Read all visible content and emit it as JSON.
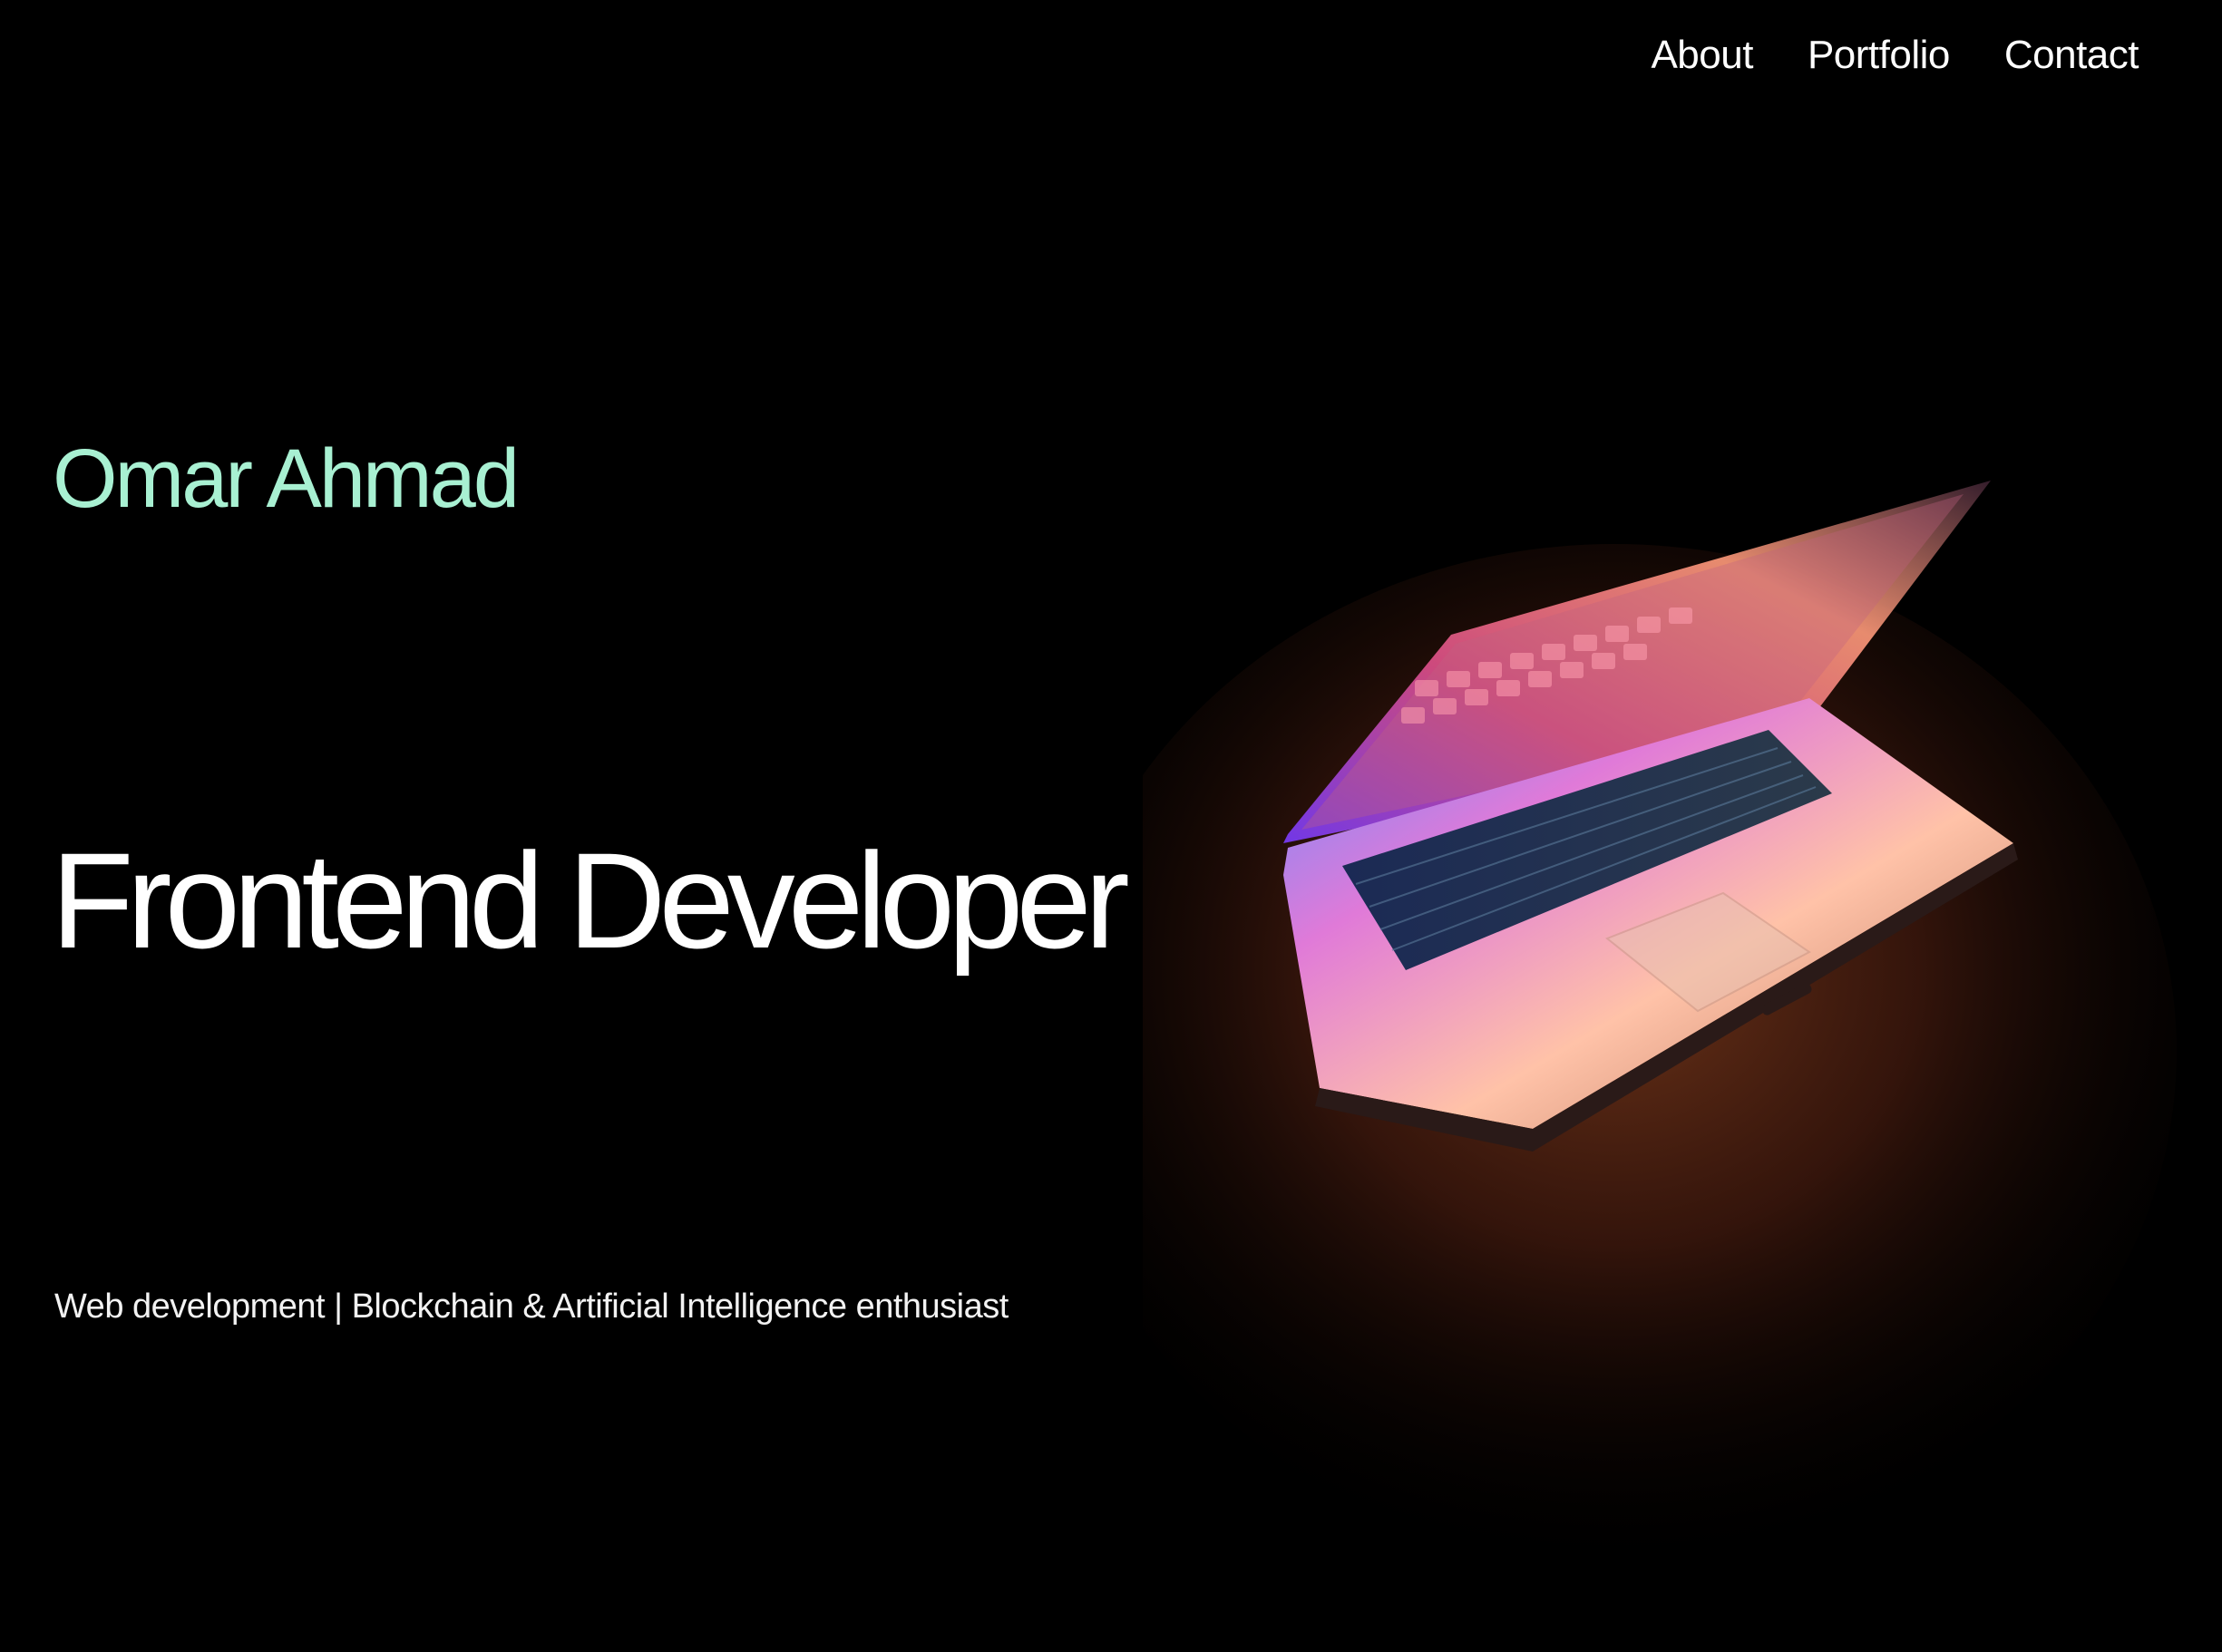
{
  "nav": {
    "items": [
      {
        "label": "About"
      },
      {
        "label": "Portfolio"
      },
      {
        "label": "Contact"
      }
    ]
  },
  "hero": {
    "name": "Omar Ahmad",
    "role": "Frontend Developer",
    "tagline": "Web development | Blockchain & Artificial Intelligence enthusiast",
    "image_subject": "glowing-laptop-on-wooden-desk"
  },
  "colors": {
    "background": "#000000",
    "name_accent": "#a8f0d2",
    "text": "#ffffff"
  }
}
